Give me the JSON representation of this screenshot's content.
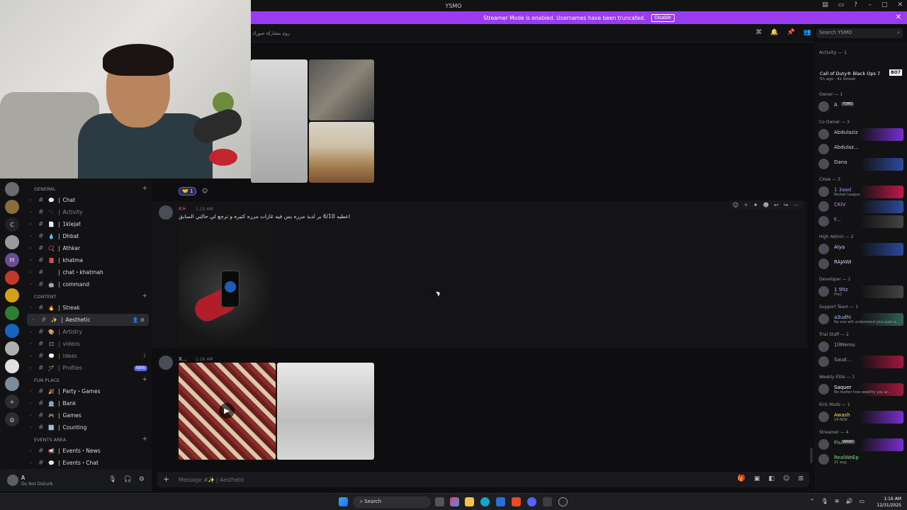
{
  "window": {
    "title": "YSMO"
  },
  "streamer_banner": {
    "text": "Streamer Mode is enabled. Usernames have been truncated.",
    "disable_label": "Disable"
  },
  "header": {
    "channel_topic": "روم مشاركة صورك",
    "search_placeholder": "Search YSMO"
  },
  "sidebar": {
    "categories": [
      {
        "name": "GENERAL",
        "channels": [
          {
            "emoji": "💬",
            "name": "Chat",
            "dim": false
          },
          {
            "emoji": "〽",
            "name": "Activity",
            "dim": true
          },
          {
            "emoji": "📄",
            "name": "1klejat",
            "dim": false
          },
          {
            "emoji": "💧",
            "name": "Dhbat",
            "dim": false
          },
          {
            "emoji": "📿",
            "name": "Athkar",
            "dim": false
          },
          {
            "emoji": "📕",
            "name": "khatma",
            "dim": false
          },
          {
            "emoji": "",
            "name": "chat・khatmah",
            "dim": false
          },
          {
            "emoji": "🤖",
            "name": "command",
            "dim": false
          }
        ]
      },
      {
        "name": "CONTENT",
        "channels": [
          {
            "emoji": "🔥",
            "name": "Streak",
            "dim": false
          },
          {
            "emoji": "✨",
            "name": "Aesthetic",
            "dim": false,
            "active": true
          },
          {
            "emoji": "🎨",
            "name": "Artistry",
            "dim": true
          },
          {
            "emoji": "🎞",
            "name": "videos",
            "dim": true
          },
          {
            "emoji": "💭",
            "name": "ideas",
            "dim": true,
            "count": "1"
          },
          {
            "emoji": "🪄",
            "name": "Profiles",
            "dim": true,
            "badge": "NEW"
          }
        ]
      },
      {
        "name": "FUN PLACE",
        "channels": [
          {
            "emoji": "🎉",
            "name": "Party・Games",
            "dim": false
          },
          {
            "emoji": "🏦",
            "name": "Bank",
            "dim": false
          },
          {
            "emoji": "🎮",
            "name": "Games",
            "dim": false
          },
          {
            "emoji": "🔢",
            "name": "Counting",
            "dim": false
          }
        ]
      },
      {
        "name": "EVENTS AREA",
        "channels": [
          {
            "emoji": "📢",
            "name": "Events・News",
            "dim": false
          },
          {
            "emoji": "💬",
            "name": "Events・Chat",
            "dim": false
          }
        ]
      }
    ]
  },
  "user_panel": {
    "name": "A",
    "status": "Do Not Disturb"
  },
  "messages": [
    {
      "reaction": "1"
    },
    {
      "author": "K✈",
      "time": "1:15 AM",
      "text": "اعطيه 6/10 بر لذيذ مرره بس فيه غازات مرره كثيره و ترجع لي حالتي السابق"
    },
    {
      "author": "X...",
      "time": "1:16 AM"
    }
  ],
  "composer": {
    "placeholder": "Message #✨ | Aesthetic"
  },
  "members": {
    "activity_title": "Activity — 1",
    "activity": {
      "game": "Call of Duty® Black Ops 7",
      "meta": "5h ago · 4x Streak",
      "logo": "BO7"
    },
    "groups": [
      {
        "role": "Owner — 1",
        "members": [
          {
            "name": "A",
            "tag": "YSMO"
          }
        ]
      },
      {
        "role": "Co Owner — 3",
        "members": [
          {
            "name": "Abdulaziz"
          },
          {
            "name": "Abdulaz..."
          },
          {
            "name": "Dana"
          }
        ]
      },
      {
        "role": "Close — 3",
        "members": [
          {
            "name": "1 3aad",
            "sub": "Rocket League"
          },
          {
            "name": "CKIV"
          },
          {
            "name": "F..."
          }
        ]
      },
      {
        "role": "High Admin — 2",
        "members": [
          {
            "name": "Alya"
          },
          {
            "name": "RAJAWI"
          }
        ]
      },
      {
        "role": "Developer — 1",
        "members": [
          {
            "name": "1 9ltz",
            "sub": "Pre2"
          }
        ]
      },
      {
        "role": "Support Team — 1",
        "members": [
          {
            "name": "a3udhi",
            "sub": "No one will understand your pain e..."
          }
        ]
      },
      {
        "role": "Trial Staff — 2",
        "members": [
          {
            "name": "1llMemo"
          },
          {
            "name": "Saud..."
          }
        ]
      },
      {
        "role": "Weekly Elite — 1",
        "members": [
          {
            "name": "Saquer",
            "sub": "No matter how wealthy you ar..."
          }
        ]
      },
      {
        "role": "Kick Mods — 1",
        "members": [
          {
            "name": "Awash",
            "sub": "24 NOV"
          }
        ]
      },
      {
        "role": "Streamer — 4",
        "members": [
          {
            "name": "Fisaedx",
            "tag": "WANO"
          },
          {
            "name": "RealWeEp",
            "sub": "21 aug."
          }
        ]
      }
    ]
  },
  "taskbar": {
    "search_label": "Search",
    "time": "1:16 AM",
    "date": "12/31/2025"
  }
}
